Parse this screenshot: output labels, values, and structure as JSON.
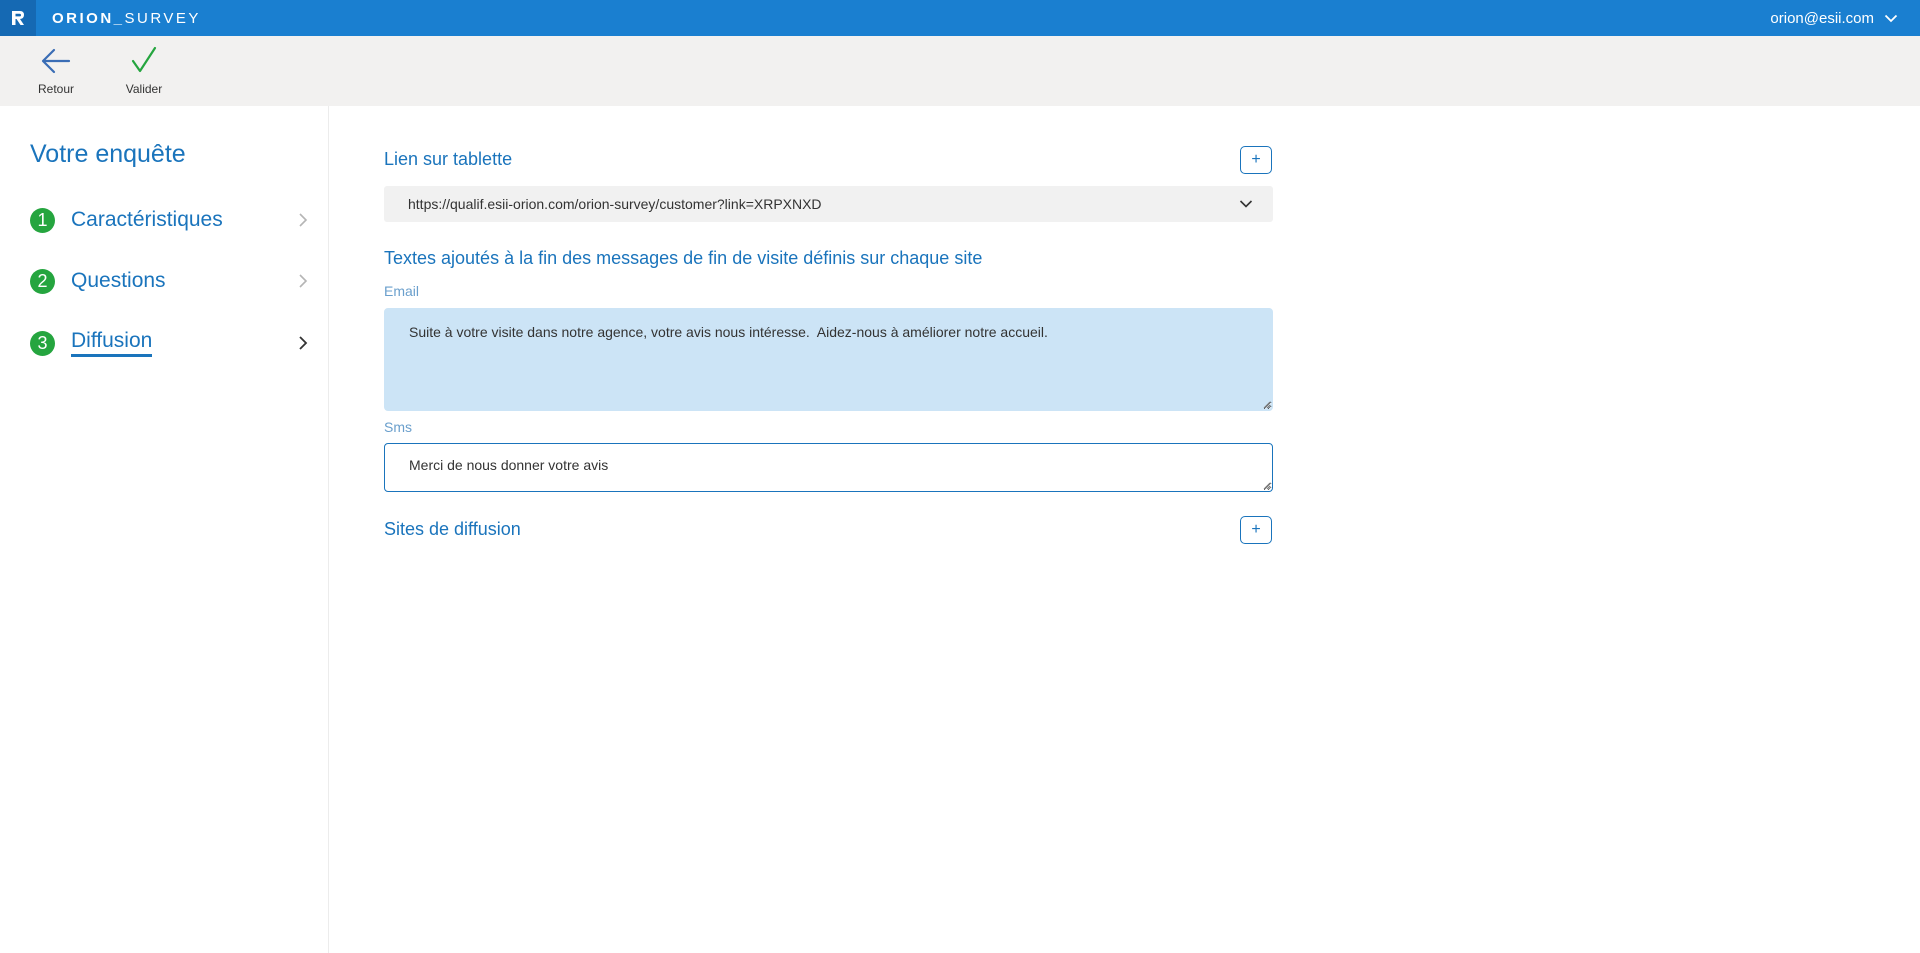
{
  "topbar": {
    "brand_bold": "ORION_",
    "brand_light": "SURVEY",
    "user_email": "orion@esii.com"
  },
  "toolbar": {
    "back_label": "Retour",
    "validate_label": "Valider"
  },
  "sidebar": {
    "title": "Votre enquête",
    "steps": [
      {
        "num": "1",
        "label": "Caractéristiques"
      },
      {
        "num": "2",
        "label": "Questions"
      },
      {
        "num": "3",
        "label": "Diffusion"
      }
    ]
  },
  "main": {
    "tablet_link_title": "Lien sur tablette",
    "tablet_link_value": "https://qualif.esii-orion.com/orion-survey/customer?link=XRPXNXD",
    "texts_title": "Textes ajoutés à la fin des messages de fin de visite définis sur chaque site",
    "email_label": "Email",
    "email_value": "Suite à votre visite dans notre agence, votre avis nous intéresse.  Aidez-nous à améliorer notre accueil.",
    "sms_label": "Sms",
    "sms_value": "Merci de nous donner votre avis",
    "sites_title": "Sites de diffusion",
    "plus_label": "+"
  },
  "colors": {
    "topbar": "#1a7fd0",
    "accent": "#1a74bc",
    "step_badge": "#25a53f",
    "email_bg": "#cce4f6"
  }
}
